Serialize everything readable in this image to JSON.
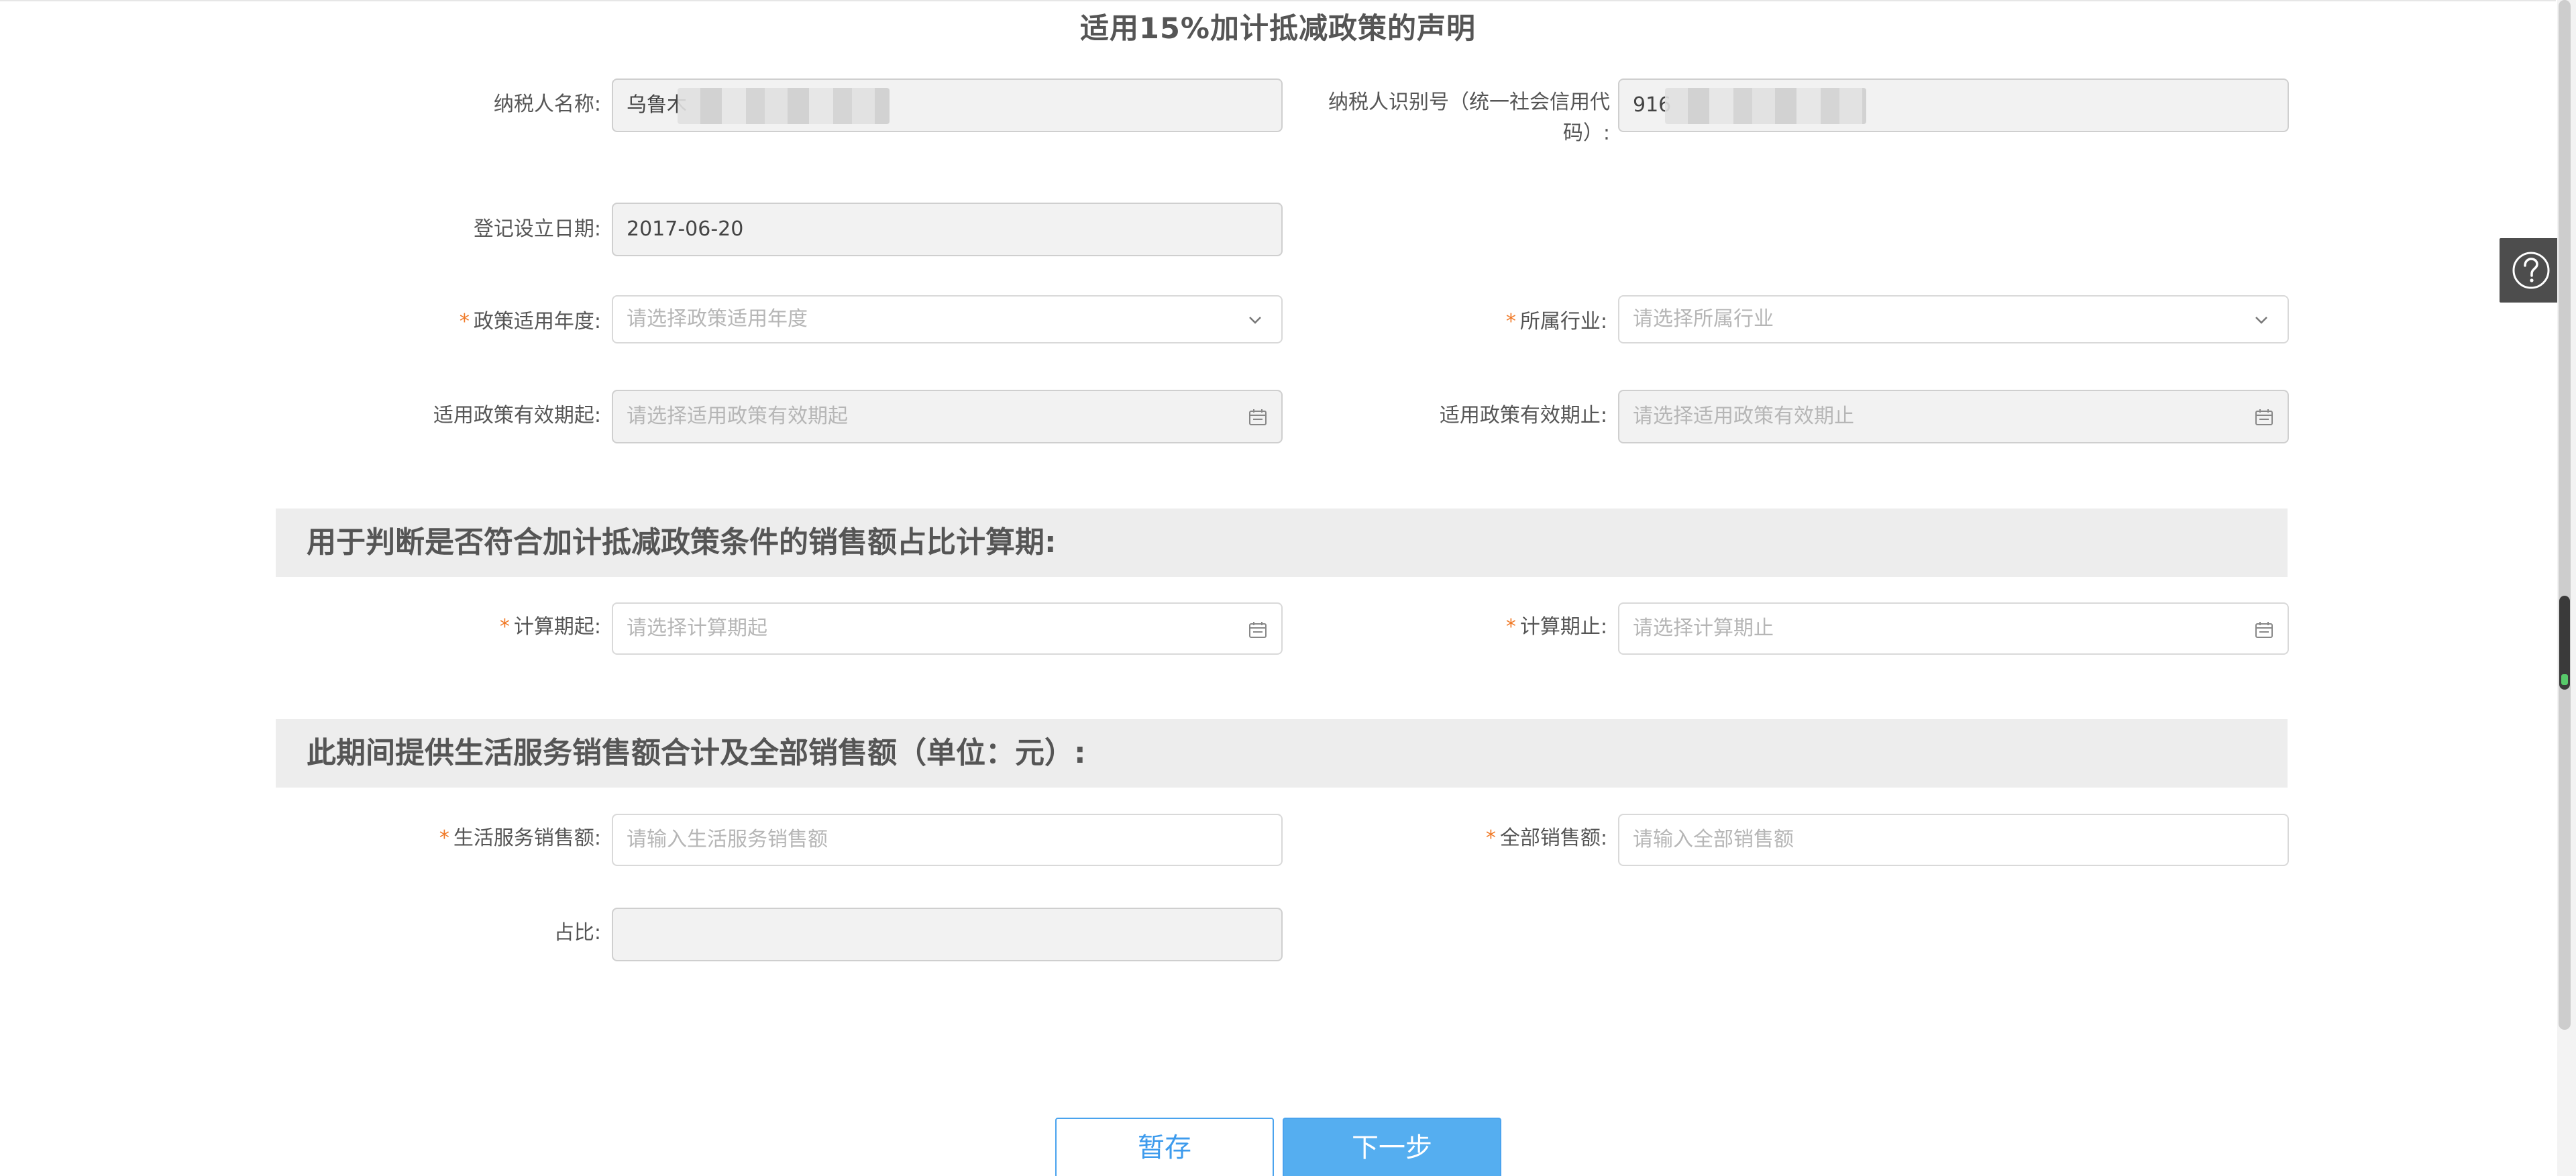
{
  "page_title": "适用15%加计抵减政策的声明",
  "fields": {
    "taxpayer_name": {
      "label": "纳税人名称:",
      "value": "乌鲁木"
    },
    "taxpayer_id": {
      "label": "纳税人识别号（统一社会信用代码）:",
      "value": "916"
    },
    "registration_date": {
      "label": "登记设立日期:",
      "value": "2017-06-20"
    },
    "policy_year": {
      "required_mark": "*",
      "label": "政策适用年度:",
      "placeholder": "请选择政策适用年度"
    },
    "industry": {
      "required_mark": "*",
      "label": "所属行业:",
      "placeholder": "请选择所属行业"
    },
    "policy_valid_start": {
      "label": "适用政策有效期起:",
      "placeholder": "请选择适用政策有效期起"
    },
    "policy_valid_end": {
      "label": "适用政策有效期止:",
      "placeholder": "请选择适用政策有效期止"
    },
    "calc_start": {
      "required_mark": "*",
      "label": "计算期起:",
      "placeholder": "请选择计算期起"
    },
    "calc_end": {
      "required_mark": "*",
      "label": "计算期止:",
      "placeholder": "请选择计算期止"
    },
    "life_service_sales": {
      "required_mark": "*",
      "label": "生活服务销售额:",
      "placeholder": "请输入生活服务销售额"
    },
    "total_sales": {
      "required_mark": "*",
      "label": "全部销售额:",
      "placeholder": "请输入全部销售额"
    },
    "ratio": {
      "label": "占比:",
      "value": ""
    }
  },
  "sections": {
    "ratio_period": "用于判断是否符合加计抵减政策条件的销售额占比计算期:",
    "sales_amounts": "此期间提供生活服务销售额合计及全部销售额（单位：元）:"
  },
  "buttons": {
    "save": "暂存",
    "next": "下一步"
  },
  "icons": {
    "help": "help-circle-icon",
    "dropdown": "chevron-down-icon",
    "calendar": "calendar-icon"
  },
  "colors": {
    "required": "#f07a28",
    "primary": "#55aef0",
    "section_bg": "#ededed"
  }
}
